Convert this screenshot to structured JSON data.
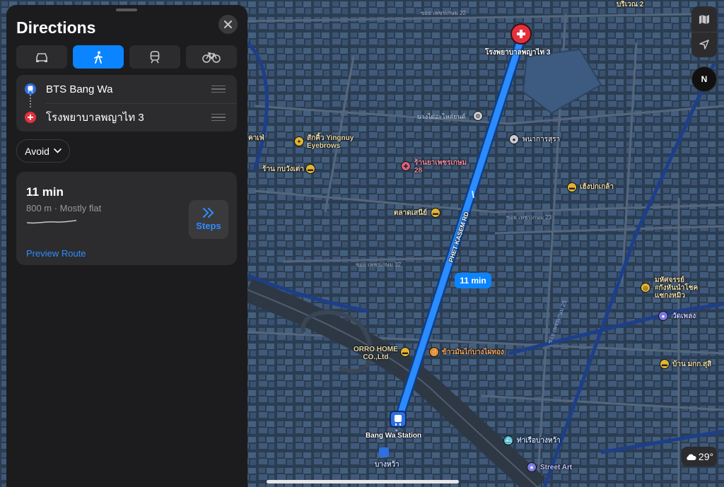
{
  "panel": {
    "title": "Directions",
    "modes": [
      {
        "name": "drive",
        "icon": "car-icon",
        "active": false
      },
      {
        "name": "walk",
        "icon": "walk-icon",
        "active": true
      },
      {
        "name": "transit",
        "icon": "train-icon",
        "active": false
      },
      {
        "name": "cycle",
        "icon": "bicycle-icon",
        "active": false
      }
    ],
    "stops": [
      {
        "label": "BTS Bang Wa",
        "icon": "train-icon",
        "color": "#2f6fe0"
      },
      {
        "label": "โรงพยาบาลพญาไท 3",
        "icon": "hospital-icon",
        "color": "#e5303c"
      }
    ],
    "avoid_label": "Avoid",
    "route": {
      "time": "11 min",
      "details": "800 m · Mostly flat",
      "steps_label": "Steps",
      "preview_label": "Preview Route"
    }
  },
  "map": {
    "eta_badge": "11 min",
    "destination_label": "โรงพยาบาลพญาไท 3",
    "station_label": "Bang Wa Station",
    "road_label": "PHET KASEM RD",
    "pois": {
      "sakkhra": "สักคิ้ว Yingnuy\nEyebrows",
      "krungwangtae": "ร้าน กบวังเต่า",
      "phetkasem_pharmacy": "ร้านยาเพชรเกษม\n28",
      "talad": "ตลาดเสนีย์",
      "bangwa_parts": "บางไผ่อะไหล่ยนต์",
      "phanakarn": "พนาการสุรา",
      "hengpak": "เฮ้งปกเกล้า",
      "orro": "ORRO HOME\nCO.,Ltd",
      "khaoman": "ข้าวมันไก่บางไผ่ทอง",
      "mahajak": "มหัศจรรย์\n#กังหันนำโชค\nแซกงหมิว",
      "watphleng": "วัดเพลง",
      "banmk": "บ้าน มกก.สุสิ",
      "pier": "ท่าเรือบางหว้า",
      "streetart": "Street Art",
      "bangwa_th": "บางหว้า",
      "kafe": "คาเฟ่",
      "bricho": "บริเวณ 2"
    },
    "streets": {
      "soi22": "ซอย เพชรเกษม 22",
      "soi23": "ซอย เพชรเกษม 23",
      "soi32": "ซอย เพชรเกษม 32",
      "soi25": "ซอย เพชรเกษม 25"
    }
  },
  "controls": {
    "map_icon": "map-icon",
    "location_icon": "location-arrow-icon",
    "compass_label": "N",
    "weather_temp": "29°"
  }
}
